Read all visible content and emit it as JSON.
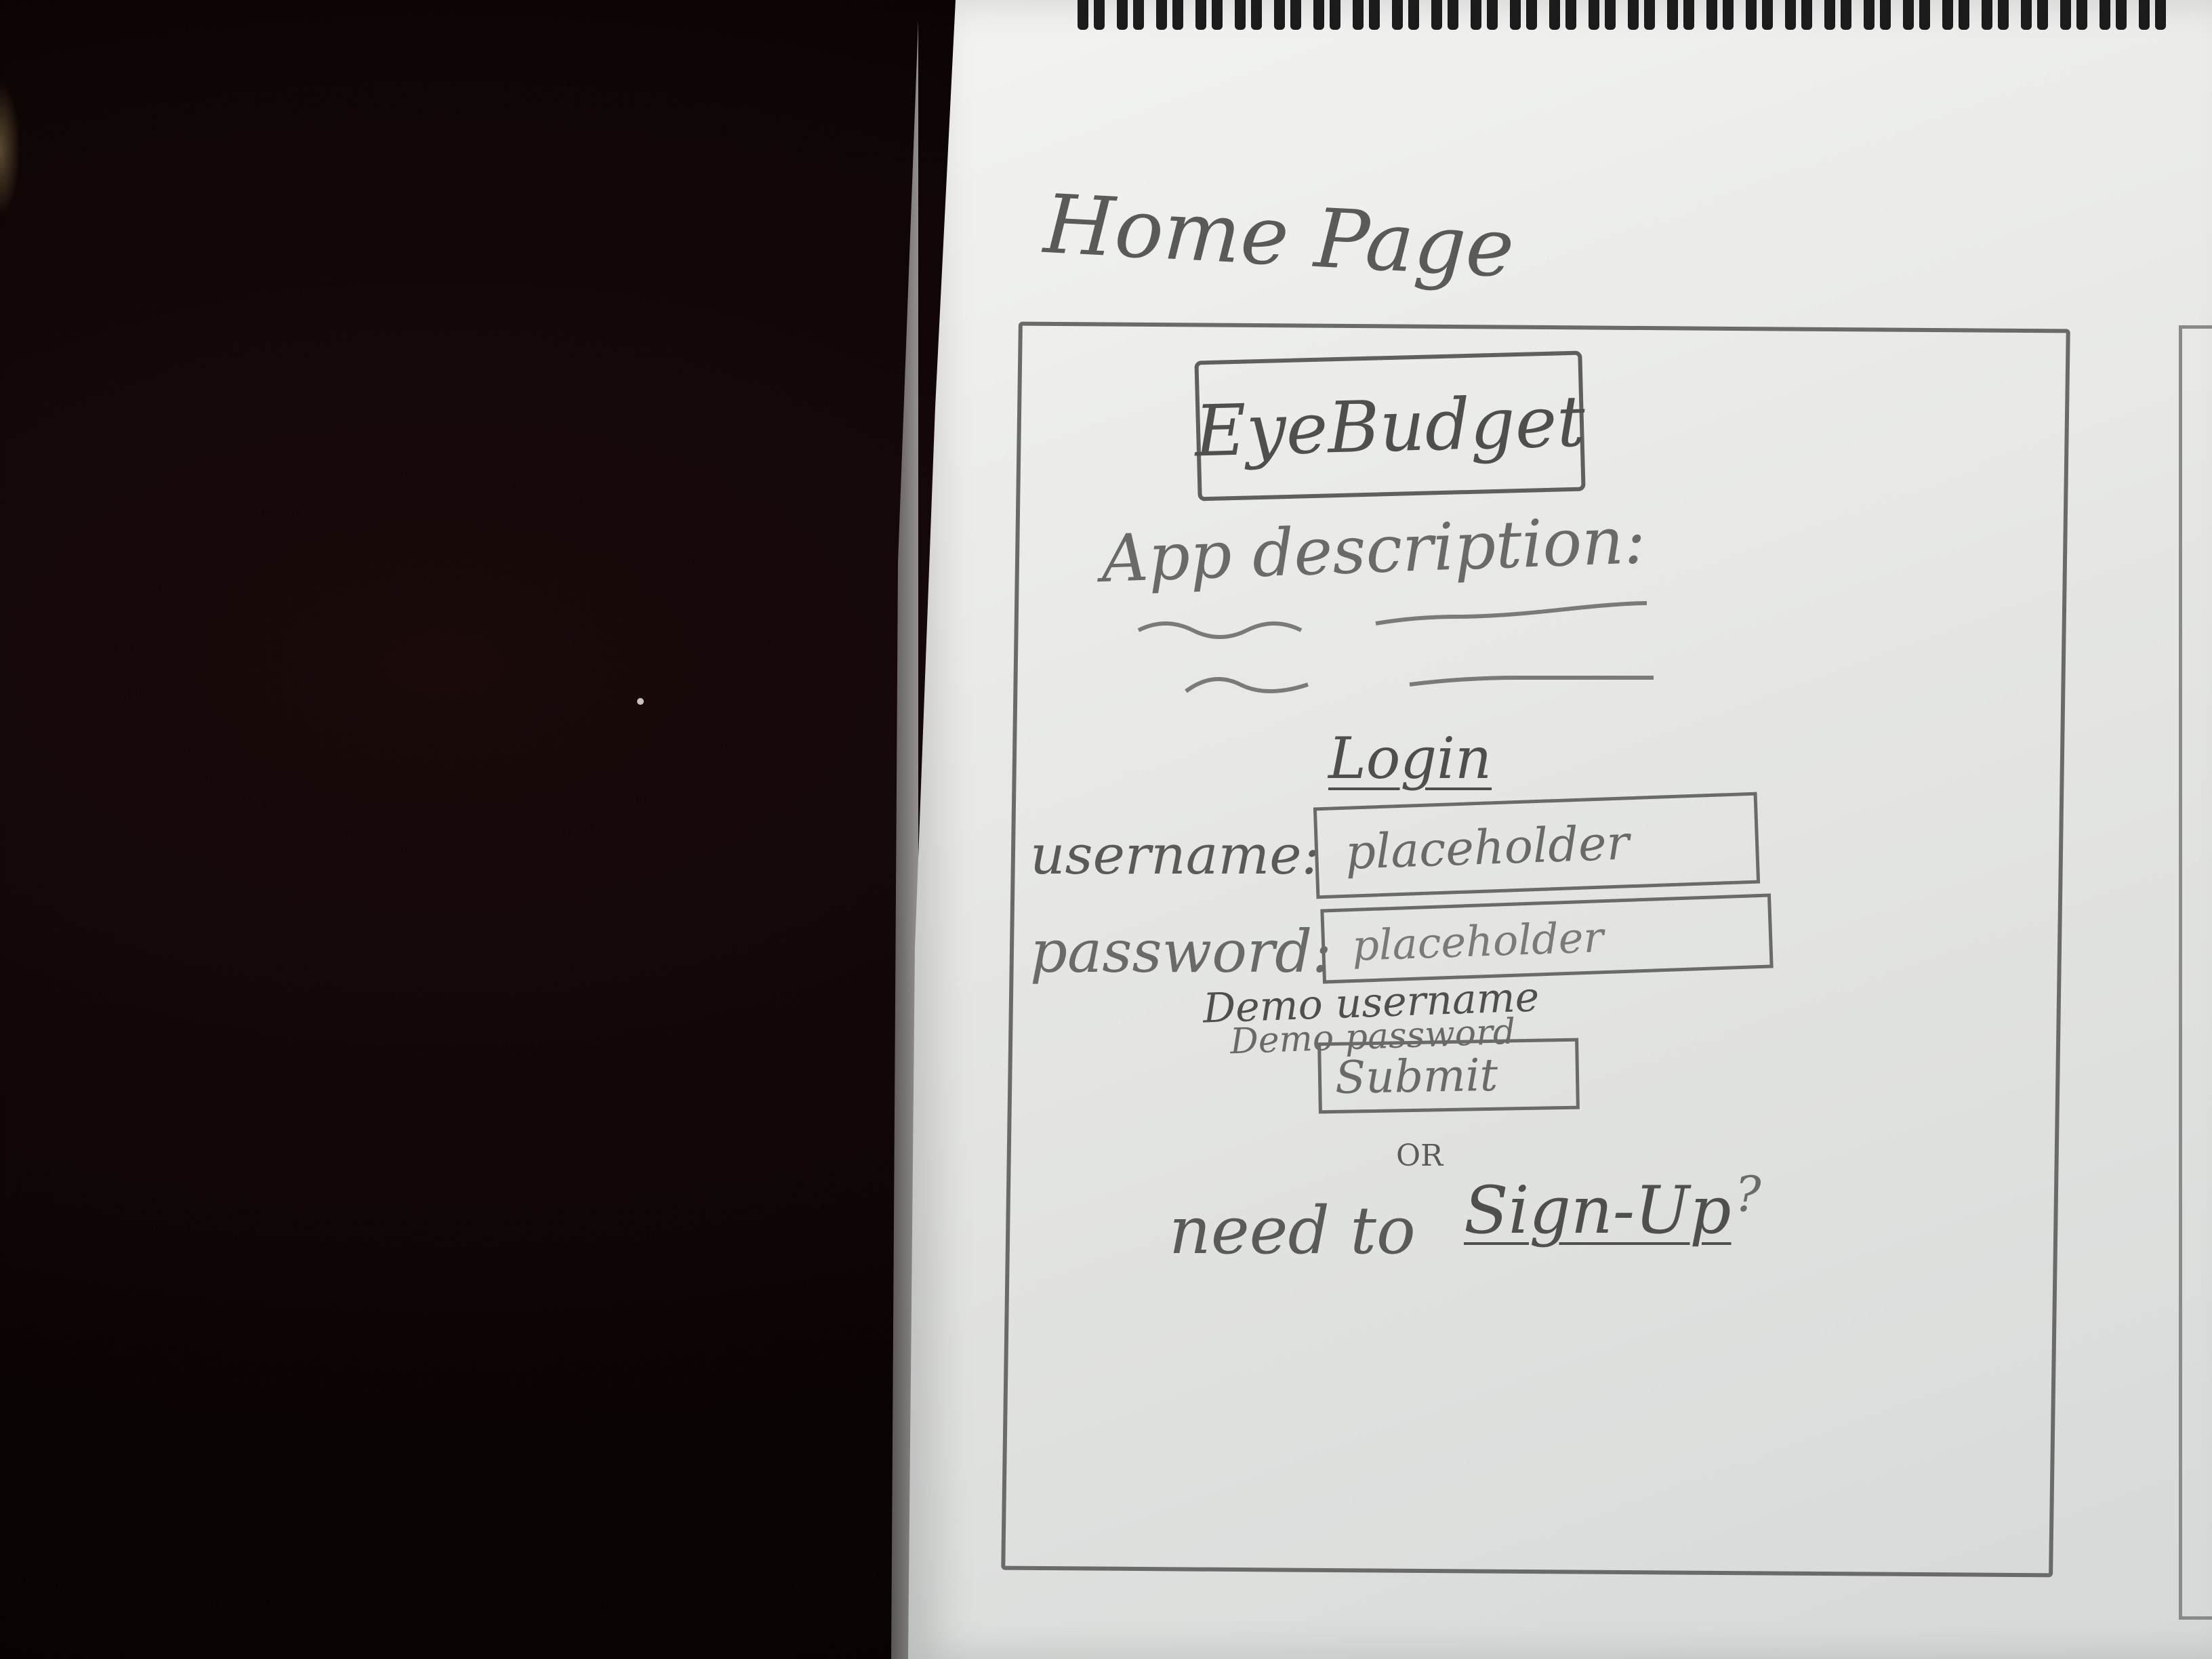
{
  "sketch": {
    "page_heading": "Home Page",
    "app_logo": "EyeBudget",
    "description_label": "App description:",
    "login_heading": "Login",
    "username_label": "username:",
    "username_placeholder": "placeholder",
    "password_label": "password:",
    "password_placeholder": "placeholder",
    "demo_username": "Demo username",
    "demo_password": "Demo password",
    "submit_label": "Submit",
    "or_text": "OR",
    "need_to": "need to",
    "signup_link": "Sign-Up",
    "question_mark": "?"
  },
  "colors": {
    "pencil": "#5a5a58",
    "paper": "#eceeeb",
    "background": "#0b0404"
  }
}
